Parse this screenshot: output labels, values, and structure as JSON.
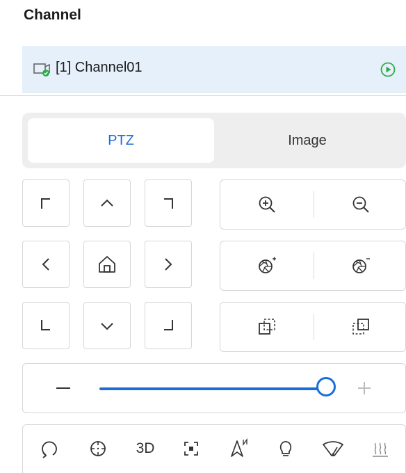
{
  "section_title": "Channel",
  "channel": {
    "label": "[1] Channel01"
  },
  "tabs": [
    {
      "label": "PTZ",
      "active": true
    },
    {
      "label": "Image",
      "active": false
    }
  ],
  "ptz_speed": {
    "value_fraction": 1.0
  },
  "tools": {
    "three_d_label": "3D"
  },
  "colors": {
    "accent": "#1a6ed8",
    "active_tab_text": "#1a6ed8",
    "channel_highlight": "#e6f0fb",
    "play_icon": "#2eaa4a"
  },
  "icons": {
    "direction": [
      "arrow-up-left-icon",
      "arrow-up-icon",
      "arrow-up-right-icon",
      "arrow-left-icon",
      "home-icon",
      "arrow-right-icon",
      "arrow-down-left-icon",
      "arrow-down-icon",
      "arrow-down-right-icon"
    ],
    "zoom": [
      "zoom-in-icon",
      "zoom-out-icon"
    ],
    "iris": [
      "iris-open-icon",
      "iris-close-icon"
    ],
    "focus": [
      "focus-near-icon",
      "focus-far-icon"
    ],
    "tools": [
      "auto-scan-icon",
      "preset-crosshair-icon",
      "3d-positioning-icon",
      "focus-frame-icon",
      "north-arrow-icon",
      "light-bulb-icon",
      "wiper-icon",
      "heater-icon"
    ]
  }
}
